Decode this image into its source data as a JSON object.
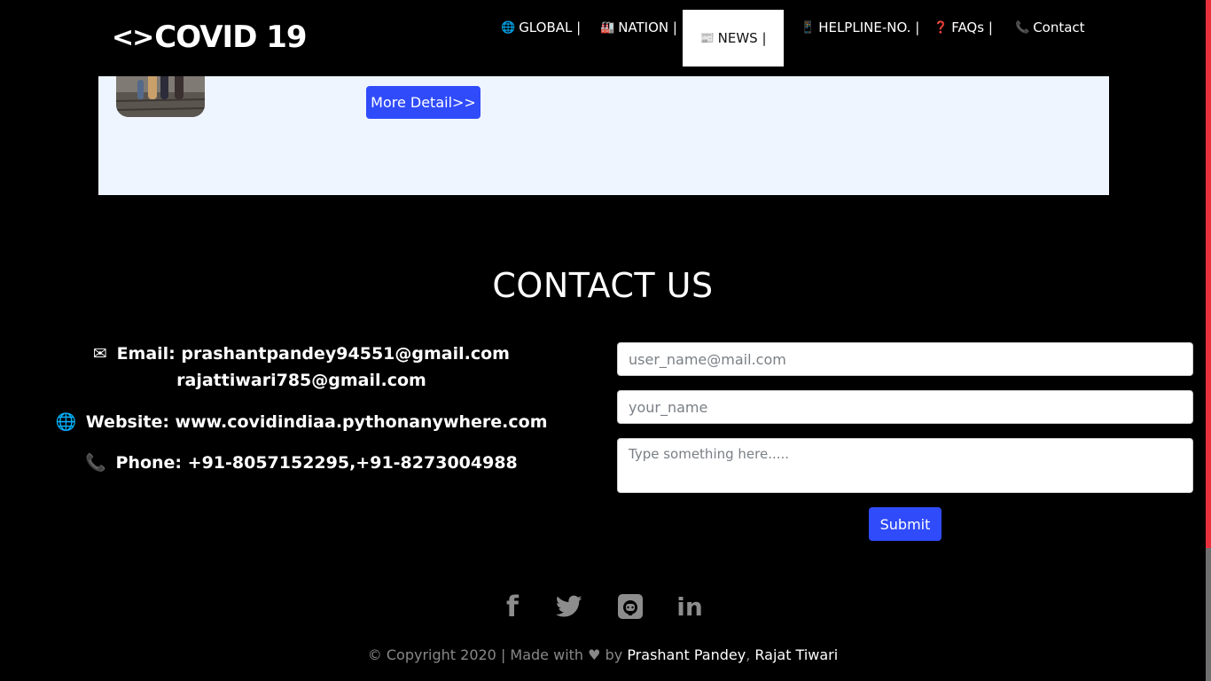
{
  "navbar": {
    "brand_icon": "<>",
    "brand_text": "COVID 19",
    "items": [
      {
        "icon": "globe-icon",
        "glyph": "🌐",
        "label": "GLOBAL |"
      },
      {
        "icon": "industry-icon",
        "glyph": "🏭",
        "label": "NATION |"
      },
      {
        "icon": "newspaper-icon",
        "glyph": "📰",
        "label": "NEWS |",
        "active": true
      },
      {
        "icon": "mobile-icon",
        "glyph": "📱",
        "label": "HELPLINE-NO. |"
      },
      {
        "icon": "question-circle-icon",
        "glyph": "❓",
        "label": "FAQs |"
      },
      {
        "icon": "phone-icon",
        "glyph": "📞",
        "label": "Contact"
      }
    ]
  },
  "news": {
    "more_label": "More Detail>>"
  },
  "contact": {
    "title": "CONTACT US",
    "email_label": "Email: prashantpandey94551@gmail.com",
    "email2": "rajattiwari785@gmail.com",
    "website_label": "Website: www.covidindiaa.pythonanywhere.com",
    "phone_label": "Phone: +91-8057152295,+91-8273004988",
    "form": {
      "email_placeholder": "user_name@mail.com",
      "name_placeholder": "your_name",
      "message_placeholder": "Type something here.....",
      "submit_label": "Submit"
    }
  },
  "social": [
    "facebook-icon",
    "twitter-icon",
    "github-icon",
    "linkedin-icon"
  ],
  "footer": {
    "prefix": "© Copyright 2020 | Made with",
    "by": "by",
    "author1": "Prashant Pandey",
    "separator": ",",
    "author2": "Rajat Tiwari"
  },
  "colors": {
    "accent": "#2f4bfa",
    "background": "#000000",
    "news_card": "#eef5ff",
    "scrollbar": "#e8303d"
  }
}
